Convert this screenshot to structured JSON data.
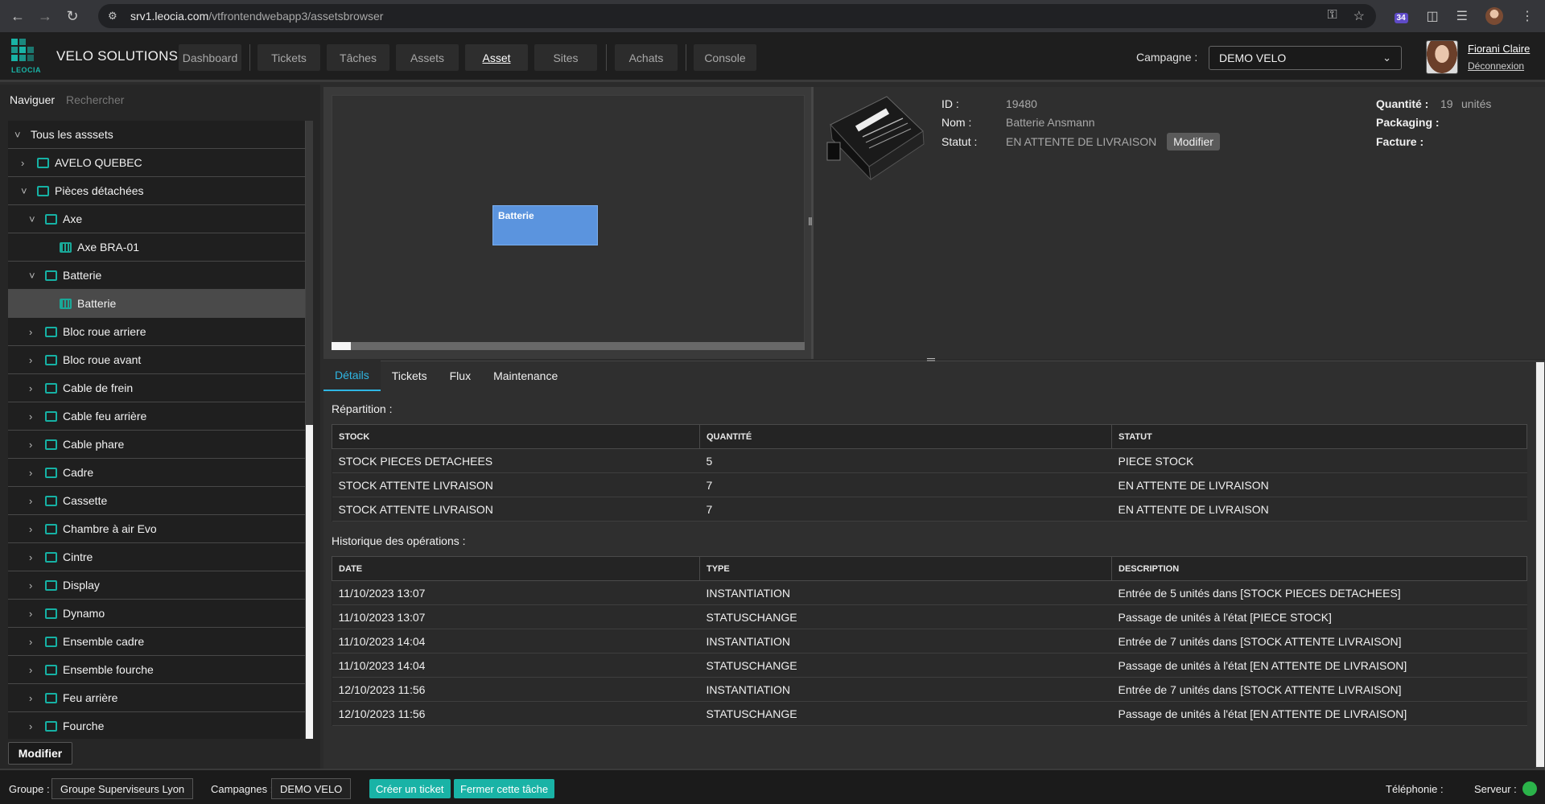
{
  "browser": {
    "url_host": "srv1.leocia.com",
    "url_path": "/vtfrontendwebapp3/assetsbrowser",
    "ext_badge": "34"
  },
  "header": {
    "logo_text": "LEOCIA",
    "brand": "VELO SOLUTIONS",
    "nav": [
      "Dashboard",
      "Tickets",
      "Tâches",
      "Assets",
      "Asset",
      "Sites",
      "Achats",
      "Console"
    ],
    "active_nav": "Asset",
    "campaign_label": "Campagne :",
    "campaign_value": "DEMO VELO",
    "user_name": "Fiorani Claire",
    "logout": "Déconnexion"
  },
  "left": {
    "tab_navigate": "Naviguer",
    "tab_search": "Rechercher",
    "modify_label": "Modifier",
    "tree": [
      {
        "label": "Tous les asssets",
        "level": 0,
        "arrow": "open",
        "icon": false
      },
      {
        "label": "AVELO QUEBEC",
        "level": 1,
        "arrow": "closed",
        "icon": "folder"
      },
      {
        "label": "Pièces détachées",
        "level": 1,
        "arrow": "open",
        "icon": "folder"
      },
      {
        "label": "Axe",
        "level": 2,
        "arrow": "open",
        "icon": "folder"
      },
      {
        "label": "Axe BRA-01",
        "level": 3,
        "arrow": "none",
        "icon": "leaf"
      },
      {
        "label": "Batterie",
        "level": 2,
        "arrow": "open",
        "icon": "folder"
      },
      {
        "label": "Batterie",
        "level": 3,
        "arrow": "none",
        "icon": "leaf",
        "selected": true
      },
      {
        "label": "Bloc roue arriere",
        "level": 2,
        "arrow": "closed",
        "icon": "folder"
      },
      {
        "label": "Bloc roue avant",
        "level": 2,
        "arrow": "closed",
        "icon": "folder"
      },
      {
        "label": "Cable de frein",
        "level": 2,
        "arrow": "closed",
        "icon": "folder"
      },
      {
        "label": "Cable feu arrière",
        "level": 2,
        "arrow": "closed",
        "icon": "folder"
      },
      {
        "label": "Cable phare",
        "level": 2,
        "arrow": "closed",
        "icon": "folder"
      },
      {
        "label": "Cadre",
        "level": 2,
        "arrow": "closed",
        "icon": "folder"
      },
      {
        "label": "Cassette",
        "level": 2,
        "arrow": "closed",
        "icon": "folder"
      },
      {
        "label": "Chambre à air Evo",
        "level": 2,
        "arrow": "closed",
        "icon": "folder"
      },
      {
        "label": "Cintre",
        "level": 2,
        "arrow": "closed",
        "icon": "folder"
      },
      {
        "label": "Display",
        "level": 2,
        "arrow": "closed",
        "icon": "folder"
      },
      {
        "label": "Dynamo",
        "level": 2,
        "arrow": "closed",
        "icon": "folder"
      },
      {
        "label": "Ensemble cadre",
        "level": 2,
        "arrow": "closed",
        "icon": "folder"
      },
      {
        "label": "Ensemble fourche",
        "level": 2,
        "arrow": "closed",
        "icon": "folder"
      },
      {
        "label": "Feu arrière",
        "level": 2,
        "arrow": "closed",
        "icon": "folder"
      },
      {
        "label": "Fourche",
        "level": 2,
        "arrow": "closed",
        "icon": "folder"
      }
    ]
  },
  "viewer": {
    "box_label": "Batterie"
  },
  "info": {
    "id_label": "ID :",
    "id_value": "19480",
    "name_label": "Nom :",
    "name_value": "Batterie Ansmann",
    "status_label": "Statut :",
    "status_value": "EN ATTENTE DE LIVRAISON",
    "modify_label": "Modifier",
    "qty_label": "Quantité :",
    "qty_value": "19",
    "qty_unit": "unités",
    "packaging_label": "Packaging :",
    "invoice_label": "Facture :"
  },
  "details": {
    "tabs": [
      "Détails",
      "Tickets",
      "Flux",
      "Maintenance"
    ],
    "active_tab": "Détails",
    "repartition_title": "Répartition :",
    "repartition_headers": [
      "STOCK",
      "QUANTITÉ",
      "STATUT"
    ],
    "repartition_rows": [
      [
        "STOCK PIECES DETACHEES",
        "5",
        "PIECE STOCK"
      ],
      [
        "STOCK ATTENTE LIVRAISON",
        "7",
        "EN ATTENTE DE LIVRAISON"
      ],
      [
        "STOCK ATTENTE LIVRAISON",
        "7",
        "EN ATTENTE DE LIVRAISON"
      ]
    ],
    "history_title": "Historique des opérations :",
    "history_headers": [
      "DATE",
      "TYPE",
      "DESCRIPTION"
    ],
    "history_rows": [
      [
        "11/10/2023 13:07",
        "INSTANTIATION",
        "Entrée de 5 unités dans [STOCK PIECES DETACHEES]"
      ],
      [
        "11/10/2023 13:07",
        "STATUSCHANGE",
        "Passage de unités à l'état [PIECE STOCK]"
      ],
      [
        "11/10/2023 14:04",
        "INSTANTIATION",
        "Entrée de 7 unités dans [STOCK ATTENTE LIVRAISON]"
      ],
      [
        "11/10/2023 14:04",
        "STATUSCHANGE",
        "Passage de unités à l'état [EN ATTENTE DE LIVRAISON]"
      ],
      [
        "12/10/2023 11:56",
        "INSTANTIATION",
        "Entrée de 7 unités dans [STOCK ATTENTE LIVRAISON]"
      ],
      [
        "12/10/2023 11:56",
        "STATUSCHANGE",
        "Passage de unités à l'état [EN ATTENTE DE LIVRAISON]"
      ]
    ]
  },
  "footer": {
    "group_label": "Groupe :",
    "group_value": "Groupe Superviseurs Lyon",
    "campaigns_label": "Campagnes :",
    "campaigns_value": "DEMO VELO",
    "create_ticket": "Créer un ticket",
    "close_task": "Fermer cette tâche",
    "telephony_label": "Téléphonie :",
    "server_label": "Serveur :"
  },
  "colors": {
    "accent_teal": "#19b3a6",
    "tab_blue": "#2fb7e4",
    "canvas_box": "#5b94de",
    "server_ok": "#2bb34a"
  }
}
